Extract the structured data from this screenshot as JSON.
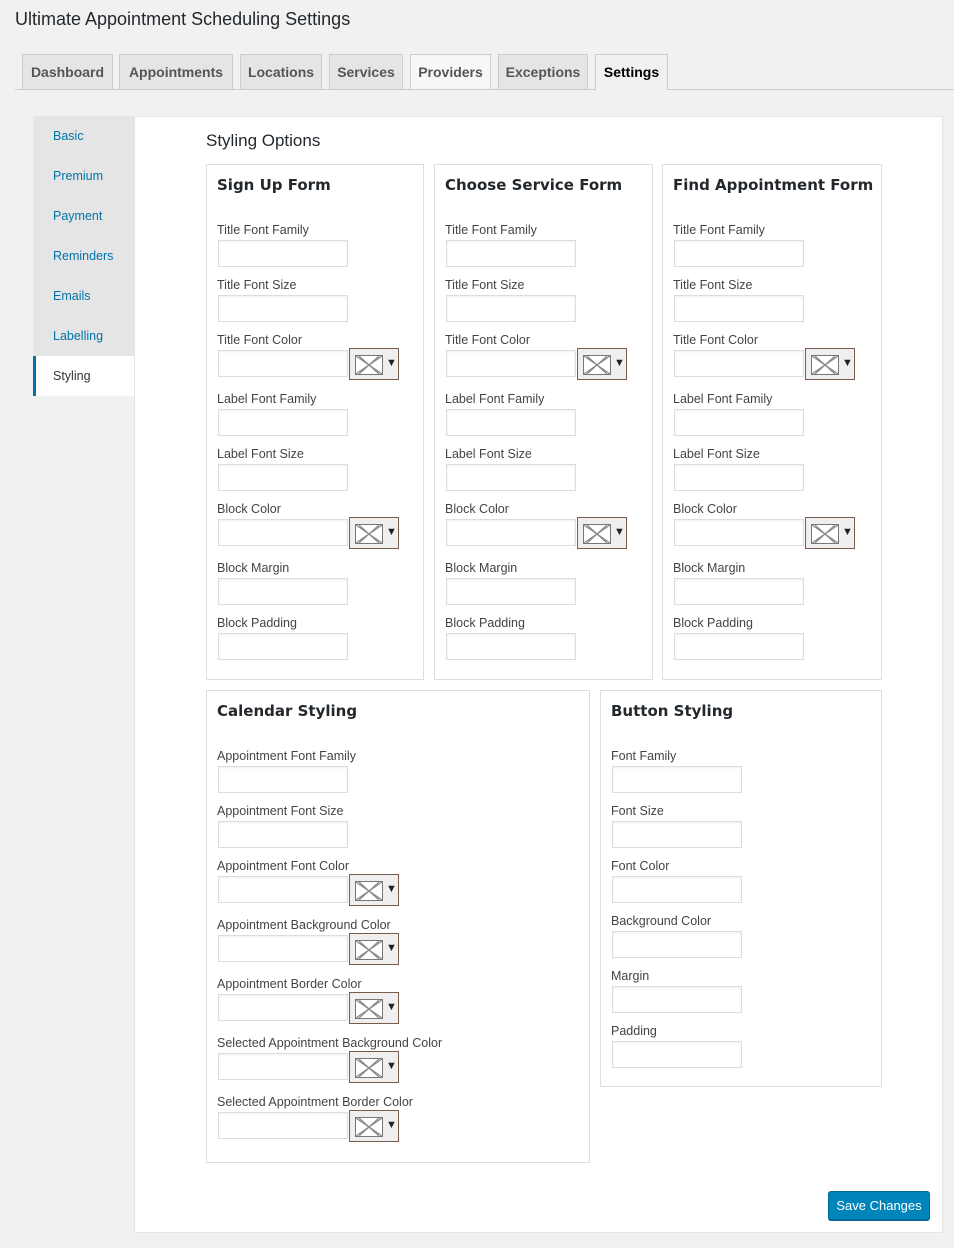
{
  "page": {
    "title": "Ultimate Appointment Scheduling Settings"
  },
  "tabs": [
    {
      "label": "Dashboard",
      "active": false
    },
    {
      "label": "Appointments",
      "active": false
    },
    {
      "label": "Locations",
      "active": false
    },
    {
      "label": "Services",
      "active": false
    },
    {
      "label": "Providers",
      "active": false
    },
    {
      "label": "Exceptions",
      "active": false
    },
    {
      "label": "Settings",
      "active": true
    }
  ],
  "sidebar": {
    "items": [
      {
        "label": "Basic",
        "active": false
      },
      {
        "label": "Premium",
        "active": false
      },
      {
        "label": "Payment",
        "active": false
      },
      {
        "label": "Reminders",
        "active": false
      },
      {
        "label": "Emails",
        "active": false
      },
      {
        "label": "Labelling",
        "active": false
      },
      {
        "label": "Styling",
        "active": true
      }
    ]
  },
  "main": {
    "section_title": "Styling Options",
    "save_label": "Save Changes",
    "sign_up_form": {
      "title": "Sign Up Form",
      "fields": [
        {
          "label": "Title Font Family",
          "value": "",
          "color_picker": false
        },
        {
          "label": "Title Font Size",
          "value": "",
          "color_picker": false
        },
        {
          "label": "Title Font Color",
          "value": "",
          "color_picker": true
        },
        {
          "label": "Label Font Family",
          "value": "",
          "color_picker": false
        },
        {
          "label": "Label Font Size",
          "value": "",
          "color_picker": false
        },
        {
          "label": "Block Color",
          "value": "",
          "color_picker": true
        },
        {
          "label": "Block Margin",
          "value": "",
          "color_picker": false
        },
        {
          "label": "Block Padding",
          "value": "",
          "color_picker": false
        }
      ]
    },
    "choose_service_form": {
      "title": "Choose Service Form",
      "fields": [
        {
          "label": "Title Font Family",
          "value": "",
          "color_picker": false
        },
        {
          "label": "Title Font Size",
          "value": "",
          "color_picker": false
        },
        {
          "label": "Title Font Color",
          "value": "",
          "color_picker": true
        },
        {
          "label": "Label Font Family",
          "value": "",
          "color_picker": false
        },
        {
          "label": "Label Font Size",
          "value": "",
          "color_picker": false
        },
        {
          "label": "Block Color",
          "value": "",
          "color_picker": true
        },
        {
          "label": "Block Margin",
          "value": "",
          "color_picker": false
        },
        {
          "label": "Block Padding",
          "value": "",
          "color_picker": false
        }
      ]
    },
    "find_appointment_form": {
      "title": "Find Appointment Form",
      "fields": [
        {
          "label": "Title Font Family",
          "value": "",
          "color_picker": false
        },
        {
          "label": "Title Font Size",
          "value": "",
          "color_picker": false
        },
        {
          "label": "Title Font Color",
          "value": "",
          "color_picker": true
        },
        {
          "label": "Label Font Family",
          "value": "",
          "color_picker": false
        },
        {
          "label": "Label Font Size",
          "value": "",
          "color_picker": false
        },
        {
          "label": "Block Color",
          "value": "",
          "color_picker": true
        },
        {
          "label": "Block Margin",
          "value": "",
          "color_picker": false
        },
        {
          "label": "Block Padding",
          "value": "",
          "color_picker": false
        }
      ]
    },
    "calendar_styling": {
      "title": "Calendar Styling",
      "fields": [
        {
          "label": "Appointment Font Family",
          "value": "",
          "color_picker": false
        },
        {
          "label": "Appointment Font Size",
          "value": "",
          "color_picker": false
        },
        {
          "label": "Appointment Font Color",
          "value": "",
          "color_picker": true
        },
        {
          "label": "Appointment Background Color",
          "value": "",
          "color_picker": true
        },
        {
          "label": "Appointment Border Color",
          "value": "",
          "color_picker": true
        },
        {
          "label": "Selected Appointment Background Color",
          "value": "",
          "color_picker": true
        },
        {
          "label": "Selected Appointment Border Color",
          "value": "",
          "color_picker": true
        }
      ]
    },
    "button_styling": {
      "title": "Button Styling",
      "fields": [
        {
          "label": "Font Family",
          "value": "",
          "color_picker": false
        },
        {
          "label": "Font Size",
          "value": "",
          "color_picker": false
        },
        {
          "label": "Font Color",
          "value": "",
          "color_picker": false
        },
        {
          "label": "Background Color",
          "value": "",
          "color_picker": false
        },
        {
          "label": "Margin",
          "value": "",
          "color_picker": false
        },
        {
          "label": "Padding",
          "value": "",
          "color_picker": false
        }
      ]
    }
  },
  "colors": {
    "accent": "#0073aa",
    "button": "#0085ba",
    "background": "#f1f1f1"
  },
  "icons": {
    "color_swatch": "no-color-x-icon",
    "dropdown": "triangle-down-icon"
  }
}
